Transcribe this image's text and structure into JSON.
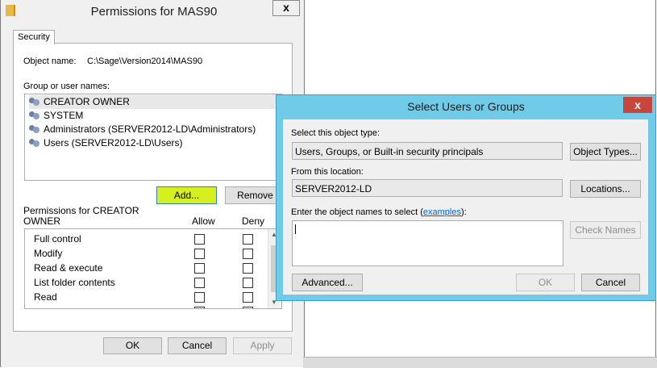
{
  "permissions_window": {
    "title": "Permissions for MAS90",
    "close_label": "x",
    "tab": "Security",
    "object_name_label": "Object name:",
    "object_name_value": "C:\\Sage\\Version2014\\MAS90",
    "group_label": "Group or user names:",
    "users": [
      "CREATOR OWNER",
      "SYSTEM",
      "Administrators (SERVER2012-LD\\Administrators)",
      "Users (SERVER2012-LD\\Users)"
    ],
    "add_label": "Add...",
    "remove_label": "Remove",
    "permissions_label_line1": "Permissions for CREATOR",
    "permissions_label_line2": "OWNER",
    "allow_label": "Allow",
    "deny_label": "Deny",
    "permissions": [
      "Full control",
      "Modify",
      "Read & execute",
      "List folder contents",
      "Read"
    ],
    "ok_label": "OK",
    "cancel_label": "Cancel",
    "apply_label": "Apply"
  },
  "select_dialog": {
    "title": "Select Users or Groups",
    "close_label": "x",
    "object_type_label": "Select this object type:",
    "object_type_value": "Users, Groups, or Built-in security principals",
    "object_types_button": "Object Types...",
    "location_label": "From this location:",
    "location_value": "SERVER2012-LD",
    "locations_button": "Locations...",
    "enter_names_label_prefix": "Enter the object names to select (",
    "examples_link": "examples",
    "enter_names_label_suffix": "):",
    "names_value": "",
    "check_names_button": "Check Names",
    "advanced_button": "Advanced...",
    "ok_button": "OK",
    "cancel_button": "Cancel"
  },
  "colors": {
    "select_dialog_frame": "#6fcbe8",
    "close_button_red": "#c7463b",
    "add_button_highlight": "#d4f01e",
    "link": "#0066cc"
  }
}
